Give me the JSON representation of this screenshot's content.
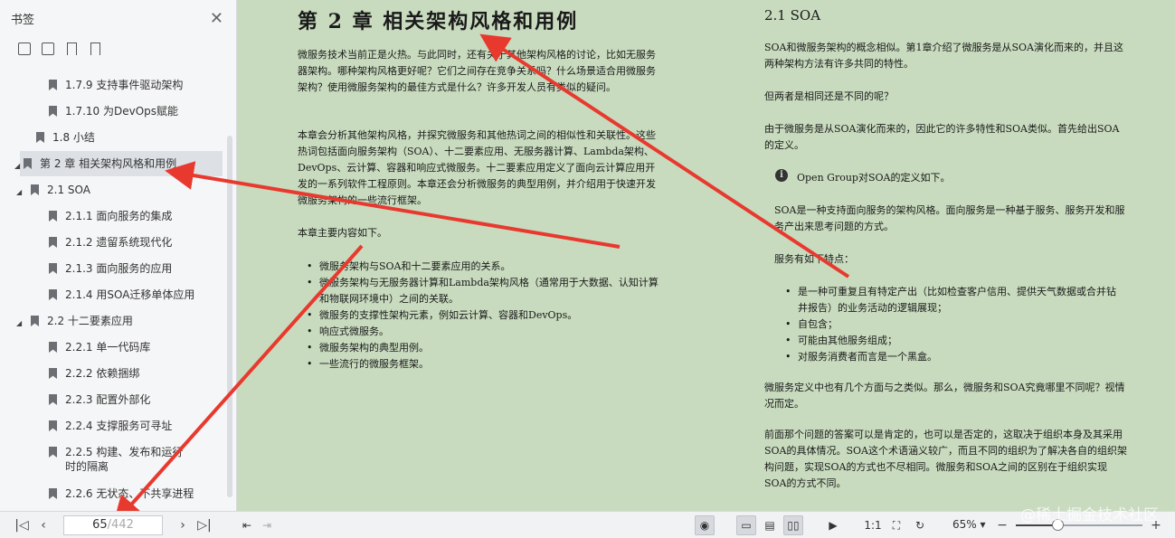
{
  "sidebar": {
    "title": "书签",
    "tree": [
      {
        "label": "1.7.9   支持事件驱动架构",
        "toggle": ""
      },
      {
        "label": "1.7.10   为DevOps赋能",
        "toggle": ""
      },
      {
        "label": "1.8   小结",
        "toggle": ""
      },
      {
        "label": "第 2 章   相关架构风格和用例",
        "toggle": "◢",
        "selected": true
      },
      {
        "label": "2.1   SOA",
        "toggle": "◢"
      },
      {
        "label": "2.1.1   面向服务的集成",
        "toggle": ""
      },
      {
        "label": "2.1.2   遗留系统现代化",
        "toggle": ""
      },
      {
        "label": "2.1.3   面向服务的应用",
        "toggle": ""
      },
      {
        "label": "2.1.4   用SOA迁移单体应用",
        "toggle": ""
      },
      {
        "label": "2.2   十二要素应用",
        "toggle": "◢"
      },
      {
        "label": "2.2.1   单一代码库",
        "toggle": ""
      },
      {
        "label": "2.2.2   依赖捆绑",
        "toggle": ""
      },
      {
        "label": "2.2.3   配置外部化",
        "toggle": ""
      },
      {
        "label": "2.2.4   支撑服务可寻址",
        "toggle": ""
      },
      {
        "label": "2.2.5   构建、发布和运行时的隔离",
        "toggle": ""
      },
      {
        "label": "2.2.6   无状态、不共享进程",
        "toggle": ""
      }
    ]
  },
  "left_page": {
    "chapter_title": "第 2 章   相关架构风格和用例",
    "para1": "微服务技术当前正是火热。与此同时，还有关于其他架构风格的讨论，比如无服务器架构。哪种架构风格更好呢？它们之间存在竞争关系吗？什么场景适合用微服务架构？使用微服务架构的最佳方式是什么？许多开发人员有类似的疑问。",
    "para2": "本章会分析其他架构风格，并探究微服务和其他热词之间的相似性和关联性。这些热词包括面向服务架构（SOA）、十二要素应用、无服务器计算、Lambda架构、DevOps、云计算、容器和响应式微服务。十二要素应用定义了面向云计算应用开发的一系列软件工程原则。本章还会分析微服务的典型用例，并介绍用于快速开发微服务架构的一些流行框架。",
    "para3": "本章主要内容如下。",
    "bullets": [
      "微服务架构与SOA和十二要素应用的关系。",
      "微服务架构与无服务器计算和Lambda架构风格（通常用于大数据、认知计算和物联网环境中）之间的关联。",
      "微服务的支撑性架构元素，例如云计算、容器和DevOps。",
      "响应式微服务。",
      "微服务架构的典型用例。",
      "一些流行的微服务框架。"
    ]
  },
  "right_page": {
    "section_title": "2.1   SOA",
    "para1": "SOA和微服务架构的概念相似。第1章介绍了微服务是从SOA演化而来的，并且这两种架构方法有许多共同的特性。",
    "para2": "但两者是相同还是不同的呢？",
    "para3": "由于微服务是从SOA演化而来的，因此它的许多特性和SOA类似。首先给出SOA的定义。",
    "note": "Open Group对SOA的定义如下。",
    "quote": "SOA是一种支持面向服务的架构风格。面向服务是一种基于服务、服务开发和服务产出来思考问题的方式。",
    "features_intro": "服务有如下特点：",
    "features": [
      "是一种可重复且有特定产出（比如检查客户信用、提供天气数据或合并钻井报告）的业务活动的逻辑展现；",
      "自包含；",
      "可能由其他服务组成；",
      "对服务消费者而言是一个黑盒。"
    ],
    "para4": "微服务定义中也有几个方面与之类似。那么，微服务和SOA究竟哪里不同呢？视情况而定。",
    "para5": "前面那个问题的答案可以是肯定的，也可以是否定的，这取决于组织本身及其采用SOA的具体情况。SOA这个术语涵义较广，而且不同的组织为了解决各自的组织架构问题，实现SOA的方式也不尽相同。微服务和SOA之间的区别在于组织实现SOA的方式不同。"
  },
  "statusbar": {
    "current_page": "65",
    "total_pages": "/442",
    "zoom": "65%",
    "zoom_level": 0.33
  },
  "watermark": "@稀土掘金技术社区",
  "colors": {
    "page_bg": "#c8dbbe",
    "arrow": "#e8392f"
  }
}
